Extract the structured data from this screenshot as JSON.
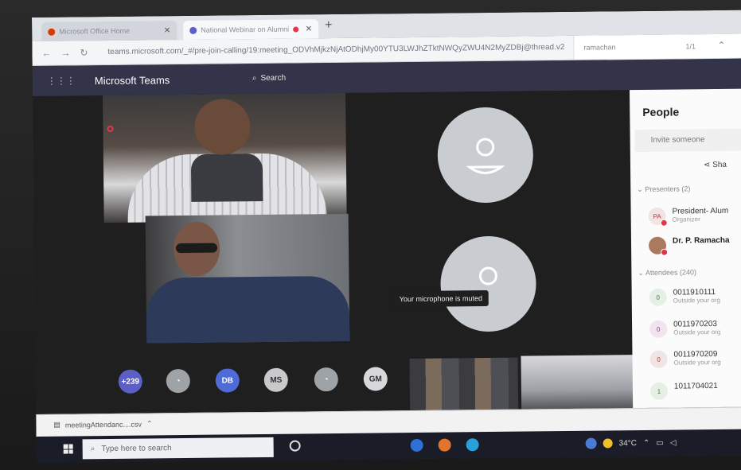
{
  "browser": {
    "tabs": [
      {
        "label": "Microsoft Office Home",
        "icon": "office-icon",
        "color": "#d83b01"
      },
      {
        "label": "National Webinar on Alumni",
        "icon": "teams-icon",
        "color": "#5b5fc7"
      }
    ],
    "url": "teams.microsoft.com/_#/pre-join-calling/19:meeting_ODVhMjkzNjAtODhjMy00YTU3LWJhZTktNWQyZWU4N2MyZDBj@thread.v2",
    "find": {
      "query": "ramachan",
      "count": "1/1"
    }
  },
  "teams": {
    "app_title": "Microsoft Teams",
    "search_placeholder": "Search"
  },
  "meeting": {
    "toast": "Your microphone is muted",
    "strip": {
      "overflow_count": "+239",
      "chips": [
        "DB",
        "MS",
        "GM"
      ]
    }
  },
  "people_panel": {
    "title": "People",
    "invite_placeholder": "Invite someone",
    "share_label": "Sha",
    "presenters_header": "Presenters (2)",
    "presenters": [
      {
        "initials": "PA",
        "name": "President- Alum",
        "sub": "Organizer"
      },
      {
        "initials": "",
        "name": "Dr. P. Ramacha",
        "sub": ""
      }
    ],
    "attendees_header": "Attendees (240)",
    "attendees": [
      {
        "initials": "0",
        "name": "0011910111",
        "sub": "Outside your org"
      },
      {
        "initials": "0",
        "name": "0011970203",
        "sub": "Outside your org"
      },
      {
        "initials": "0",
        "name": "0011970209",
        "sub": "Outside your org"
      },
      {
        "initials": "1",
        "name": "1011704021",
        "sub": ""
      }
    ]
  },
  "downloads": {
    "file": "meetingAttendanc....csv"
  },
  "taskbar": {
    "search_placeholder": "Type here to search",
    "temperature": "34°C"
  },
  "colors": {
    "teams_header": "#33344a",
    "accent": "#5b5fc7",
    "muted_red": "#e2374a"
  }
}
